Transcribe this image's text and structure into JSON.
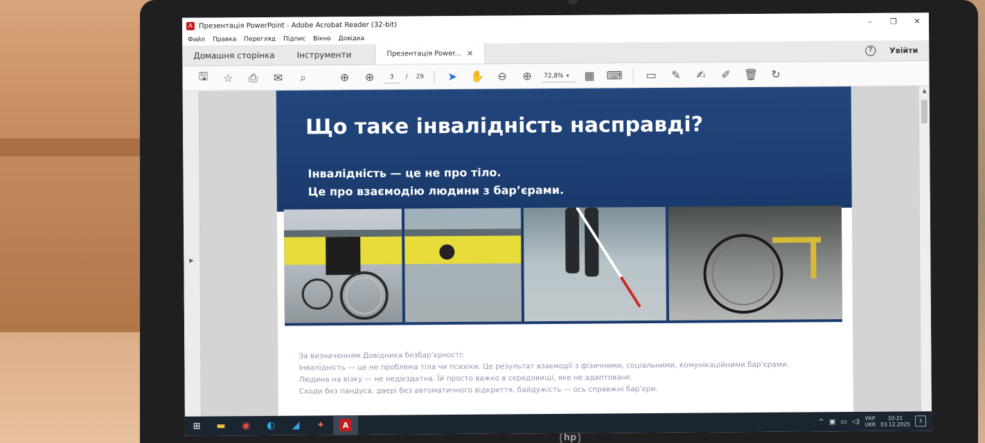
{
  "window": {
    "title": "Презентація PowerPoint - Adobe Acrobat Reader (32-bit)",
    "controls": [
      "–",
      "❐",
      "✕"
    ]
  },
  "menu": [
    "Файл",
    "Правка",
    "Перегляд",
    "Підпис",
    "Вікно",
    "Довідка"
  ],
  "tabs": {
    "home": "Домашня сторінка",
    "tools": "Інструменти",
    "document": "Презентація Power...",
    "close": "✕",
    "help": "?",
    "signin": "Увійти"
  },
  "toolbar": {
    "current_page": "3",
    "page_separator": "/",
    "total_pages": "29",
    "zoom": "72,8%"
  },
  "icons": {
    "save": "save-icon",
    "bookmark": "star-icon",
    "print": "printer-icon",
    "email": "mail-icon",
    "search": "zoom-search-icon",
    "prev": "arrow-up-circle-icon",
    "next": "arrow-down-circle-icon",
    "select": "cursor-icon",
    "hand": "hand-icon",
    "zoom_out": "minus-circle-icon",
    "zoom_in": "plus-circle-icon",
    "fit": "page-fit-icon",
    "scroll_mode": "keyboard-scroll-icon",
    "comment": "comment-icon",
    "highlight": "pen-icon",
    "sign": "sign-icon",
    "stamp": "stamp-icon",
    "delete": "trash-icon",
    "rotate": "rotate-icon"
  },
  "slide": {
    "title": "Що таке інвалідність насправді?",
    "subtitle_line1": "Інвалідність — це не про тіло.",
    "subtitle_line2": "Це про взаємодію людини з бар’єрами.",
    "body_lines": [
      "За визначенням Довідника безбар’єрності:",
      "Інвалідність — це не проблема тіла чи психіки. Це результат взаємодії з фізичними, соціальними, комунікаційними бар’єрами.",
      "Людина на візку — не недієздатна. Їй просто важко в середовищі, яке не адаптоване.",
      "Сходи без пандуса, двері без автоматичного відкриття, байдужість — ось справжні бар’єри."
    ]
  },
  "taskbar": {
    "lang_top": "УКР",
    "lang_bottom": "UKR",
    "time": "10:21",
    "date": "03.12.2025",
    "notifications": "3",
    "tray_chevron": "^"
  },
  "colors": {
    "slide_header": "#1f427a",
    "acrobat_red": "#c41d1d",
    "toolbar_blue": "#1f6fd1",
    "taskbar": "#1b2431"
  }
}
